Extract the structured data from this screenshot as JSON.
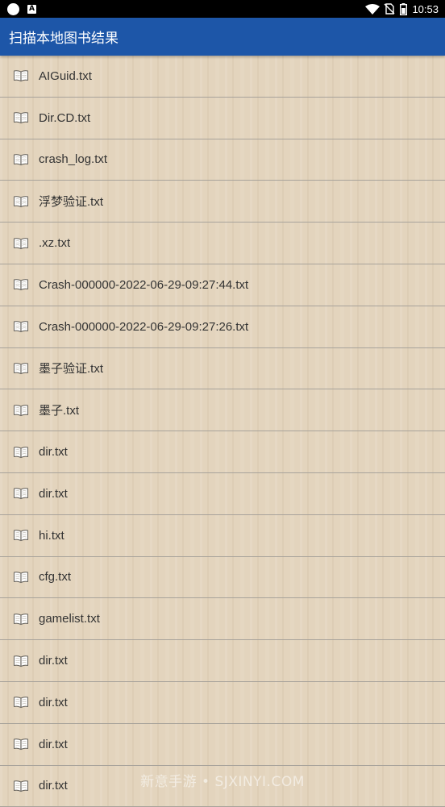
{
  "status_bar": {
    "time": "10:53",
    "left_icons": [
      "notification-dot-icon",
      "app-a-icon"
    ],
    "right_icons": [
      "wifi-icon",
      "no-sim-icon",
      "battery-icon"
    ]
  },
  "app_bar": {
    "title": "扫描本地图书结果",
    "color": "#1d56a8"
  },
  "files": [
    {
      "name": "AIGuid.txt",
      "icon": "book-icon"
    },
    {
      "name": "Dir.CD.txt",
      "icon": "book-icon"
    },
    {
      "name": "crash_log.txt",
      "icon": "book-icon"
    },
    {
      "name": "浮梦验证.txt",
      "icon": "book-icon"
    },
    {
      "name": ".xz.txt",
      "icon": "book-icon"
    },
    {
      "name": "Crash-000000-2022-06-29-09:27:44.txt",
      "icon": "book-icon"
    },
    {
      "name": "Crash-000000-2022-06-29-09:27:26.txt",
      "icon": "book-icon"
    },
    {
      "name": "墨子验证.txt",
      "icon": "book-icon"
    },
    {
      "name": "墨子.txt",
      "icon": "book-icon"
    },
    {
      "name": "dir.txt",
      "icon": "book-icon"
    },
    {
      "name": "dir.txt",
      "icon": "book-icon"
    },
    {
      "name": "hi.txt",
      "icon": "book-icon"
    },
    {
      "name": "cfg.txt",
      "icon": "book-icon"
    },
    {
      "name": "gamelist.txt",
      "icon": "book-icon"
    },
    {
      "name": "dir.txt",
      "icon": "book-icon"
    },
    {
      "name": "dir.txt",
      "icon": "book-icon"
    },
    {
      "name": "dir.txt",
      "icon": "book-icon"
    },
    {
      "name": "dir.txt",
      "icon": "book-icon"
    }
  ],
  "watermark": "新意手游 • SJXINYI.COM"
}
